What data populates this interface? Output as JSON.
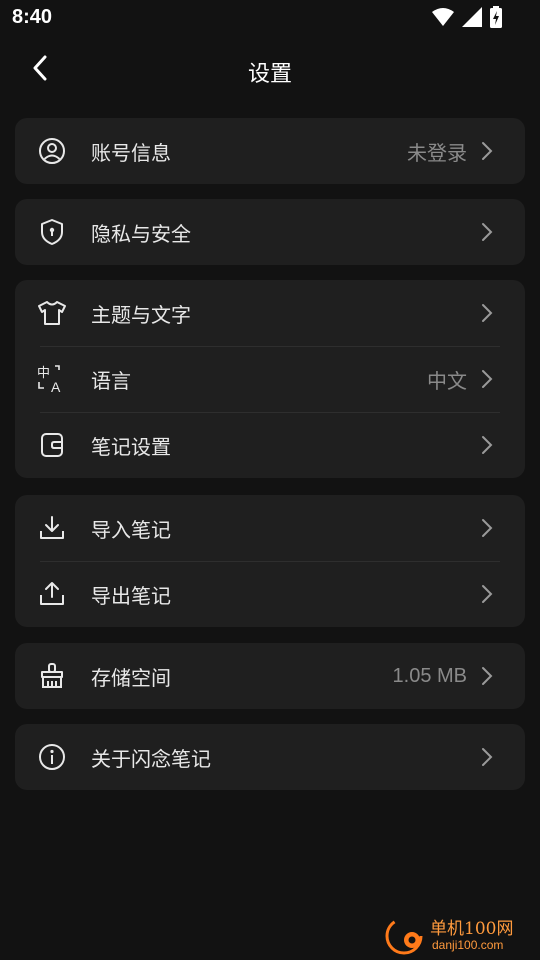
{
  "status_bar": {
    "time": "8:40"
  },
  "header": {
    "title": "设置"
  },
  "groups": [
    {
      "items": [
        {
          "label": "账号信息",
          "value": "未登录",
          "icon": "user-circle-icon"
        }
      ]
    },
    {
      "items": [
        {
          "label": "隐私与安全",
          "icon": "shield-keyhole-icon"
        }
      ]
    },
    {
      "items": [
        {
          "label": "主题与文字",
          "icon": "tshirt-icon"
        },
        {
          "label": "语言",
          "value": "中文",
          "icon": "translate-icon"
        },
        {
          "label": "笔记设置",
          "icon": "note-icon"
        }
      ]
    },
    {
      "items": [
        {
          "label": "导入笔记",
          "icon": "download-icon"
        },
        {
          "label": "导出笔记",
          "icon": "upload-icon"
        }
      ]
    },
    {
      "items": [
        {
          "label": "存储空间",
          "value": "1.05 MB",
          "icon": "broom-icon"
        }
      ]
    },
    {
      "items": [
        {
          "label": "关于闪念笔记",
          "icon": "info-icon"
        }
      ]
    }
  ],
  "watermark": {
    "line1": "单机100网",
    "line2": "danji100.com"
  },
  "colors": {
    "background": "#121212",
    "card": "#1f1f1f",
    "text": "#e8e8e8",
    "secondary": "#8a8a8a",
    "watermark": "#ff9a3d"
  }
}
